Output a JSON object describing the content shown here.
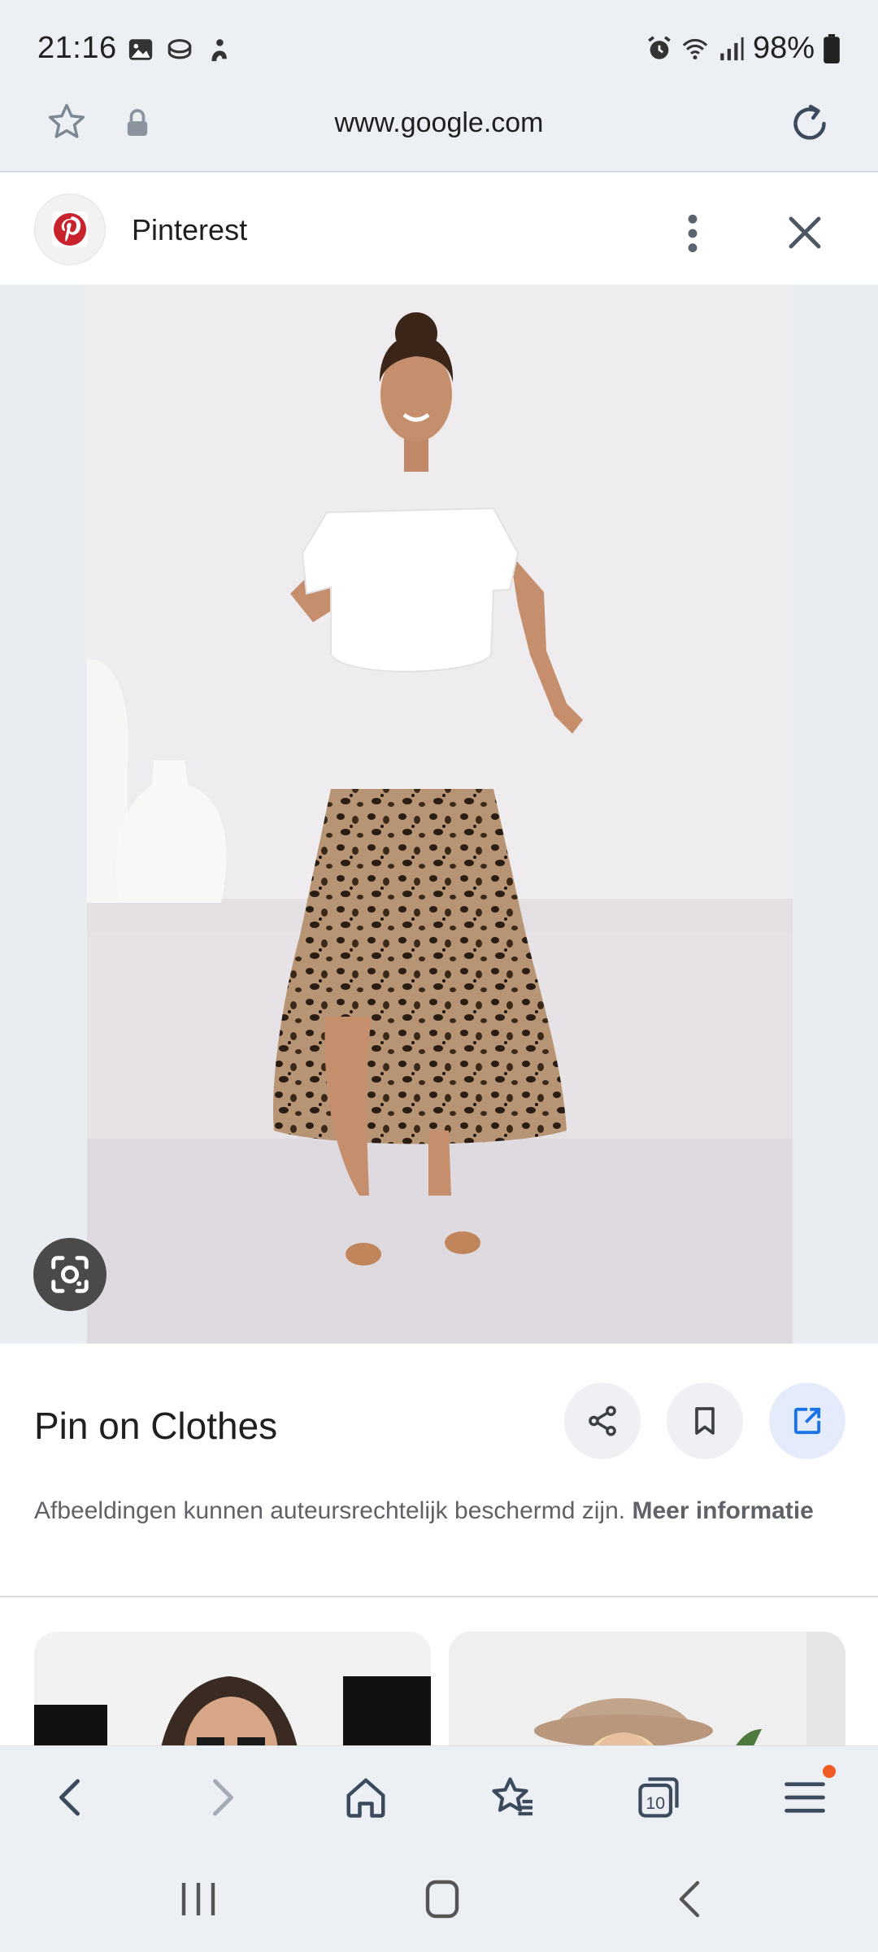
{
  "status_bar": {
    "time": "21:16",
    "battery_text": "98%",
    "left_icons": [
      "gallery-icon",
      "app-icon",
      "app-icon"
    ],
    "right_icons": [
      "alarm-icon",
      "wifi-icon",
      "signal-icon",
      "battery-icon"
    ]
  },
  "browser": {
    "url": "www.google.com"
  },
  "source": {
    "name": "Pinterest"
  },
  "result": {
    "title": "Pin on Clothes",
    "disclaimer_text": "Afbeeldingen kunnen auteursrechtelijk beschermd zijn. ",
    "disclaimer_link": "Meer informatie"
  },
  "colors": {
    "accent": "#1a73e8",
    "pinterest_red": "#e60023",
    "notification_dot": "#ef5b25"
  },
  "toolbar": {
    "tabs_count": "10"
  }
}
